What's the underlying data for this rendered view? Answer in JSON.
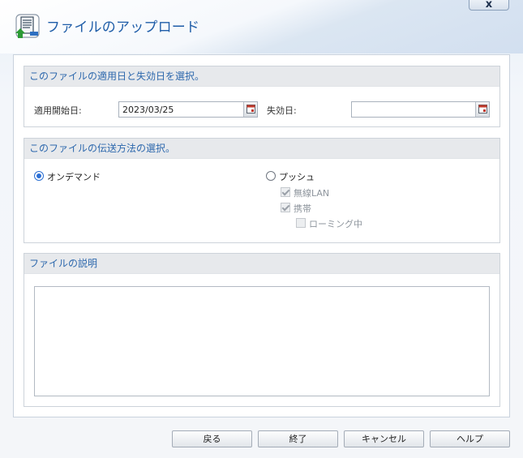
{
  "window": {
    "title": "ファイルのアップロード",
    "close_label": "x"
  },
  "dates_panel": {
    "heading": "このファイルの適用日と失効日を選択。",
    "start_label": "適用開始日:",
    "start_value": "2023/03/25",
    "end_label": "失効日:",
    "end_value": ""
  },
  "delivery_panel": {
    "heading": "このファイルの伝送方法の選択。",
    "on_demand_label": "オンデマンド",
    "on_demand_selected": true,
    "push_label": "プッシュ",
    "push_selected": false,
    "wireless_lan_label": "無線LAN",
    "wireless_lan_checked": true,
    "mobile_label": "携帯",
    "mobile_checked": true,
    "roaming_label": "ローミング中",
    "roaming_checked": false
  },
  "description_panel": {
    "heading": "ファイルの説明",
    "value": ""
  },
  "buttons": {
    "back": "戻る",
    "finish": "終了",
    "cancel": "キャンセル",
    "help": "ヘルプ"
  }
}
